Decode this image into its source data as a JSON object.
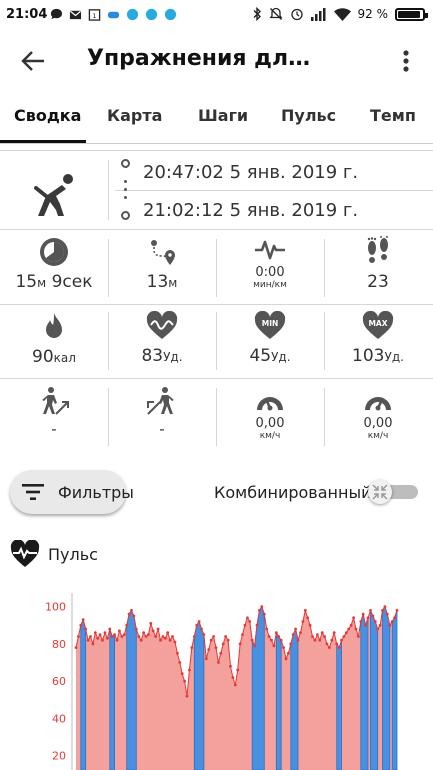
{
  "status_bar": {
    "time": "21:04",
    "battery_text": "92 %",
    "battery_level": 0.92
  },
  "app_bar": {
    "title": "Упражнения для с...",
    "back_icon": "arrow-left-icon",
    "share_icon": "share-icon",
    "more_icon": "more-vert-icon"
  },
  "tabs": [
    {
      "label": "Сводка",
      "active": true
    },
    {
      "label": "Карта",
      "active": false
    },
    {
      "label": "Шаги",
      "active": false
    },
    {
      "label": "Пульс",
      "active": false
    },
    {
      "label": "Темп",
      "active": false
    }
  ],
  "summary": {
    "sport_icon": "stretching-person-icon",
    "start_time": "20:47:02 5 янв. 2019 г.",
    "end_time": "21:02:12 5 янв. 2019 г.",
    "row1": [
      {
        "icon": "timer-icon",
        "value": "15",
        "unit1": "м",
        "value2": " 9",
        "unit2": "сек"
      },
      {
        "icon": "route-distance-icon",
        "value": "13",
        "unit1": "м"
      },
      {
        "icon": "pace-heartbeat-icon",
        "value": "0:00",
        "sub": "мин/км"
      },
      {
        "icon": "footsteps-icon",
        "value": "23"
      }
    ],
    "row2": [
      {
        "icon": "flame-icon",
        "value": "90",
        "unit": "кал"
      },
      {
        "icon": "heart-wave-icon",
        "value": "83",
        "unit": "Уд."
      },
      {
        "icon": "heart-min-icon",
        "badge": "MIN",
        "value": "45",
        "unit": "Уд."
      },
      {
        "icon": "heart-max-icon",
        "badge": "MAX",
        "value": "103",
        "unit": "Уд."
      }
    ],
    "row3": [
      {
        "icon": "walk-uphill-icon",
        "value": "-"
      },
      {
        "icon": "walk-downhill-icon",
        "value": "-"
      },
      {
        "icon": "speedometer-icon",
        "value": "0,00",
        "sub": "км/ч"
      },
      {
        "icon": "speedometer-max-icon",
        "value": "0,00",
        "sub": "км/ч"
      }
    ]
  },
  "controls": {
    "filter_label": "Фильтры",
    "combined_label": "Комбинированный",
    "combined_on": false
  },
  "pulse_section": {
    "title": "Пульс",
    "icon": "heart-pulse-icon"
  },
  "colors": {
    "accent_red": "#e53935",
    "area_fill": "#f4a09c",
    "bar_blue": "#4a90e2"
  },
  "chart_data": {
    "type": "area",
    "title": "",
    "xlabel": "",
    "ylabel": "",
    "ylim": [
      0,
      110
    ],
    "yticks": [
      20,
      40,
      60,
      80,
      100
    ],
    "series": [
      {
        "values": [
          78,
          84,
          90,
          93,
          88,
          82,
          84,
          80,
          86,
          83,
          85,
          82,
          86,
          83,
          88,
          84,
          85,
          82,
          87,
          84,
          85,
          90,
          96,
          98,
          95,
          88,
          84,
          82,
          86,
          84,
          85,
          91,
          87,
          84,
          88,
          82,
          84,
          83,
          86,
          82,
          84,
          81,
          75,
          70,
          64,
          60,
          52,
          66,
          78,
          84,
          90,
          92,
          88,
          85,
          72,
          77,
          82,
          84,
          78,
          70,
          75,
          80,
          84,
          82,
          68,
          62,
          58,
          66,
          80,
          85,
          90,
          94,
          92,
          82,
          79,
          90,
          98,
          100,
          96,
          88,
          84,
          82,
          79,
          86,
          84,
          82,
          78,
          72,
          75,
          80,
          85,
          88,
          82,
          86,
          92,
          98,
          94,
          90,
          84,
          82,
          85,
          82,
          86,
          84,
          80,
          78,
          82,
          86,
          80,
          78,
          82,
          84,
          86,
          88,
          90,
          94,
          88,
          84,
          92,
          96,
          90,
          94,
          98,
          95,
          92,
          88,
          90,
          98,
          100,
          96,
          90,
          92,
          94,
          98
        ]
      }
    ],
    "highlight_bands_label": "",
    "highlight_bands": [
      [
        2,
        4
      ],
      [
        14,
        16
      ],
      [
        21,
        25
      ],
      [
        49,
        53
      ],
      [
        73,
        78
      ],
      [
        83,
        85
      ],
      [
        89,
        92
      ],
      [
        108,
        110
      ],
      [
        118,
        121
      ],
      [
        122,
        125
      ],
      [
        127,
        130
      ],
      [
        131,
        133
      ]
    ]
  }
}
